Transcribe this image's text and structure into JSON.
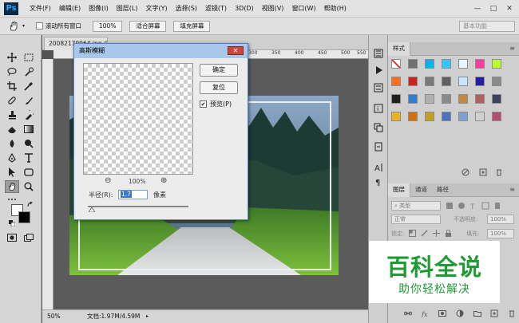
{
  "app": {
    "logo": "Ps"
  },
  "menubar": {
    "items": [
      "文件(F)",
      "编辑(E)",
      "图像(I)",
      "图层(L)",
      "文字(Y)",
      "选择(S)",
      "滤镜(T)",
      "3D(D)",
      "视图(V)",
      "窗口(W)",
      "帮助(H)"
    ],
    "window_controls": {
      "minimize": "—",
      "maximize": "□",
      "close": "✕"
    }
  },
  "optionsbar": {
    "scroll_all_windows_label": "滚动所有窗口",
    "zoom_100_label": "100%",
    "fit_screen_label": "适合屏幕",
    "fill_screen_label": "填充屏幕",
    "workspace_label": "基本功能"
  },
  "document": {
    "tab_title": "20082170064.jpg @ 5...",
    "ruler_ticks": [
      "300",
      "350",
      "400",
      "450",
      "500",
      "550"
    ],
    "status_zoom": "50%",
    "status_doc": "文档:1.97M/4.59M"
  },
  "dialog": {
    "title": "高斯模糊",
    "ok_label": "确定",
    "reset_label": "复位",
    "preview_label": "预览(P)",
    "preview_checked": "✔",
    "zoom_value": "100%",
    "zoom_out_symbol": "⊖",
    "zoom_in_symbol": "⊕",
    "radius_label": "半径(R):",
    "radius_value": "1.7",
    "radius_unit": "像素",
    "radius_slider_fraction": 0.04
  },
  "styles_panel": {
    "tab_label": "样式",
    "swatch_colors": [
      [
        "#ffffff",
        "#707070",
        "#00b4f0",
        "#37c5ff",
        "#e8f7ff",
        "#ff3aa0",
        "#b9ff2a"
      ],
      [
        "#ff6d1d",
        "#d02020",
        "#7a7a7a",
        "#606060",
        "#c9e6ff",
        "#2020a0",
        "#8a8a8a"
      ],
      [
        "#202020",
        "#2e7fd1",
        "#b0b0b0",
        "#8a8a8a",
        "#c08a40",
        "#b06060",
        "#404060"
      ],
      [
        "#f0b020",
        "#d07010",
        "#c0a020",
        "#5070c0",
        "#80a0d0",
        "#d0d0d0",
        "#b05070"
      ]
    ]
  },
  "layers_panel": {
    "tabs": [
      "图层",
      "通道",
      "路径"
    ],
    "search_placeholder": "类型",
    "blend_mode": "正常",
    "opacity_label": "不透明度:",
    "opacity_value": "100%",
    "lock_label": "锁定:",
    "fill_label": "填充:",
    "fill_value": "100%"
  },
  "watermark": {
    "title": "百科全说",
    "subtitle": "助你轻松解决"
  }
}
